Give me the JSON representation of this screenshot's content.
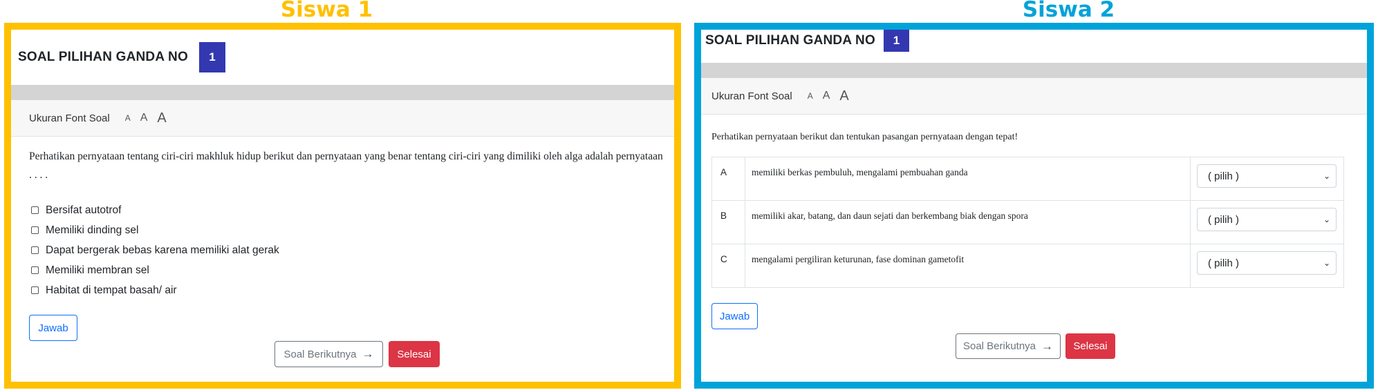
{
  "panels": {
    "left": {
      "title": "Siswa 1"
    },
    "right": {
      "title": "Siswa 2"
    }
  },
  "colors": {
    "left_frame": "#FFC000",
    "right_frame": "#00A3D9",
    "badge": "#3338B0",
    "danger": "#DC3545",
    "primary": "#0D6EFD"
  },
  "siswa1": {
    "header": "SOAL PILIHAN GANDA NO",
    "number": "1",
    "font_label": "Ukuran Font Soal",
    "font_sizes": [
      "A",
      "A",
      "A"
    ],
    "question": "Perhatikan pernyataan tentang ciri-ciri makhluk hidup berikut dan pernyataan yang benar tentang ciri-ciri yang dimiliki oleh alga adalah pernyataan . . . .",
    "options": [
      "Bersifat autotrof",
      "Memiliki dinding sel",
      "Dapat bergerak bebas karena memiliki alat gerak",
      "Memiliki membran sel",
      "Habitat di tempat basah/ air"
    ],
    "answer_button": "Jawab",
    "next_button": "Soal Berikutnya",
    "finish_button": "Selesai"
  },
  "siswa2": {
    "header": "SOAL PILIHAN GANDA NO",
    "number": "1",
    "font_label": "Ukuran Font Soal",
    "font_sizes": [
      "A",
      "A",
      "A"
    ],
    "question": "Perhatikan pernyataan berikut dan tentukan pasangan pernyataan dengan tepat!",
    "rows": [
      {
        "key": "A",
        "statement": "memiliki berkas pembuluh, mengalami pembuahan ganda",
        "select": "( pilih )"
      },
      {
        "key": "B",
        "statement": "memiliki akar, batang, dan daun sejati dan berkembang biak dengan spora",
        "select": "( pilih )"
      },
      {
        "key": "C",
        "statement": "mengalami pergiliran keturunan, fase dominan gametofit",
        "select": "( pilih )"
      }
    ],
    "answer_button": "Jawab",
    "next_button": "Soal Berikutnya",
    "finish_button": "Selesai"
  }
}
